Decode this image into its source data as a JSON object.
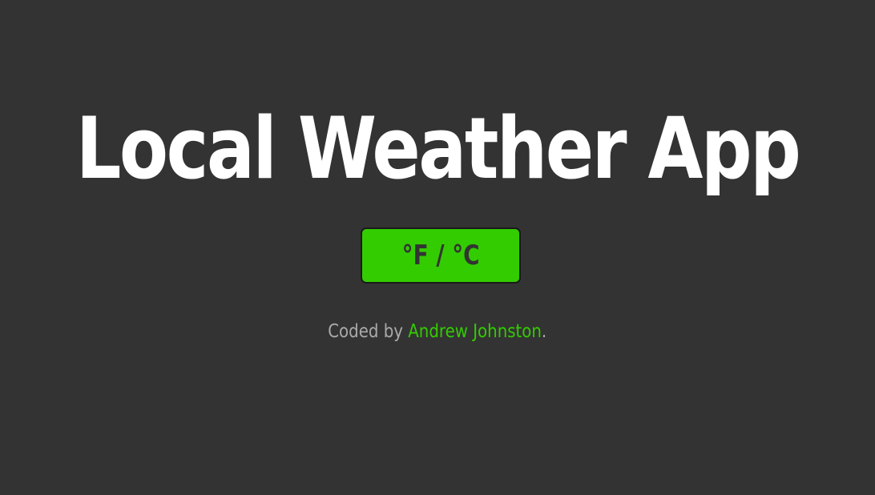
{
  "app": {
    "title": "Local Weather App"
  },
  "toggle": {
    "label": "°F / °C"
  },
  "footer": {
    "prefix": "Coded by ",
    "author": "Andrew Johnston",
    "suffix": "."
  },
  "colors": {
    "background": "#333333",
    "accent": "#33cc00",
    "title": "#ffffff",
    "muted_text": "#aaaaaa"
  }
}
